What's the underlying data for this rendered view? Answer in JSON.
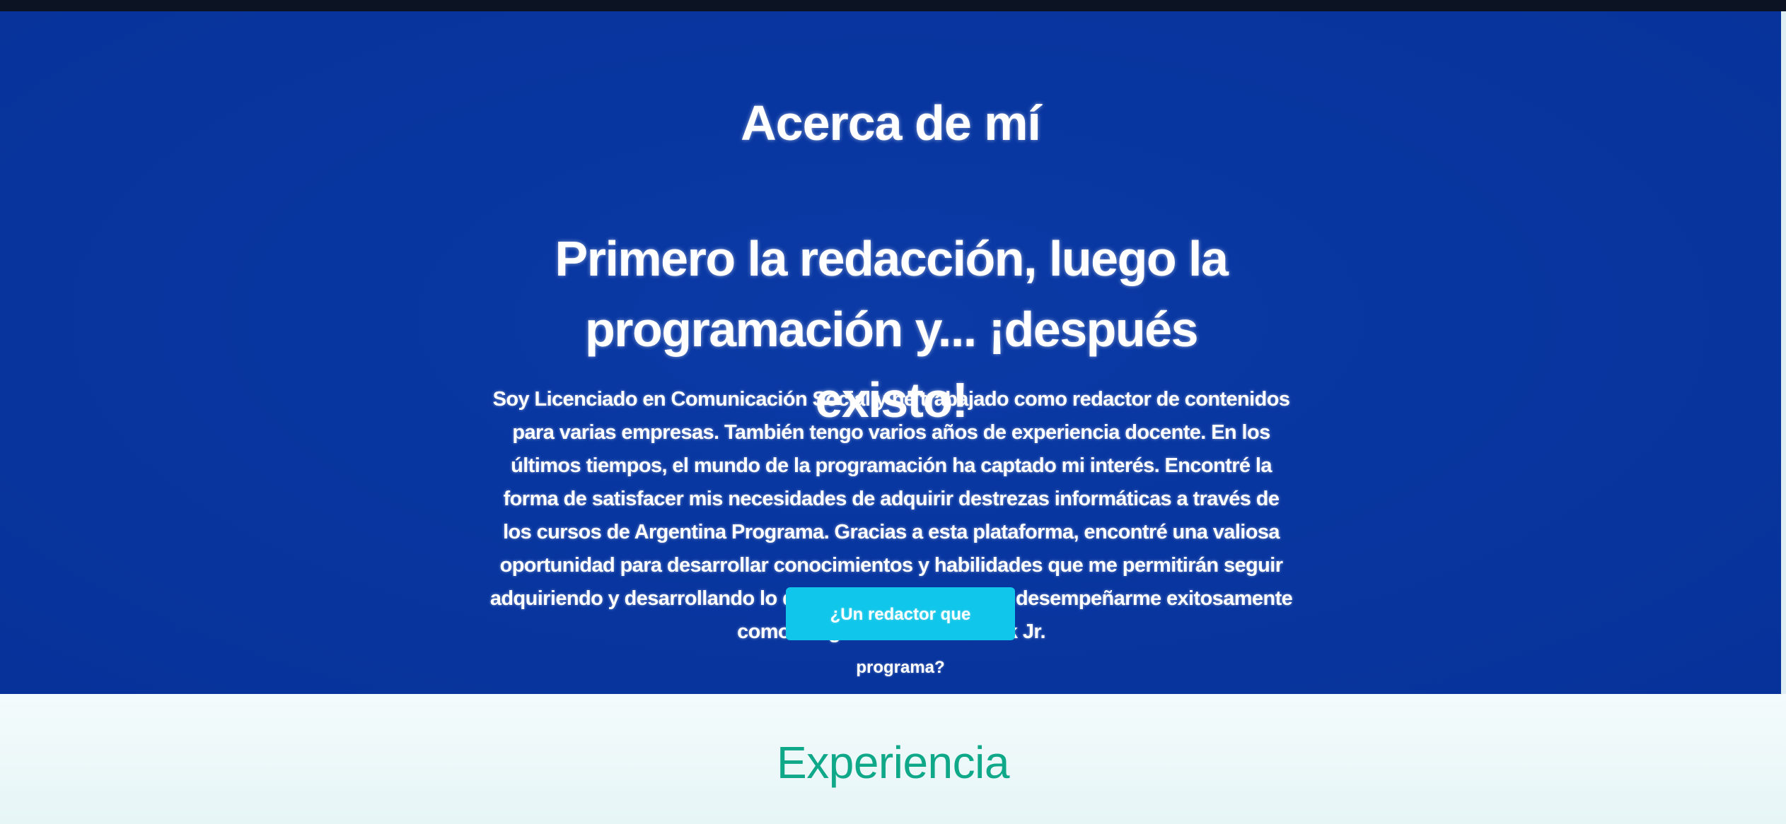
{
  "about": {
    "title": "Acerca de mí",
    "subtitle": "Primero la redacción, luego la programación y... ¡después existo!",
    "body": "Soy Licenciado en Comunicación Social y he trabajado como redactor de contenidos para varias empresas. También tengo varios años de experiencia docente. En los últimos tiempos, el mundo de la programación ha captado mi interés. Encontré la forma de satisfacer mis necesidades de adquirir destrezas informáticas a través de los cursos de Argentina Programa. Gracias a esta plataforma, encontré una valiosa oportunidad para desarrollar conocimientos y habilidades que me permitirán seguir adquiriendo y desarrollando lo que necesito para lograr desempeñarme exitosamente como Programador Full Stack Jr.",
    "cta_label": "¿Un redactor que programa?"
  },
  "experience": {
    "title": "Experiencia"
  },
  "colors": {
    "about_background": "#0836a0",
    "cta_background": "#10c6ea",
    "experience_title": "#0fa889"
  }
}
